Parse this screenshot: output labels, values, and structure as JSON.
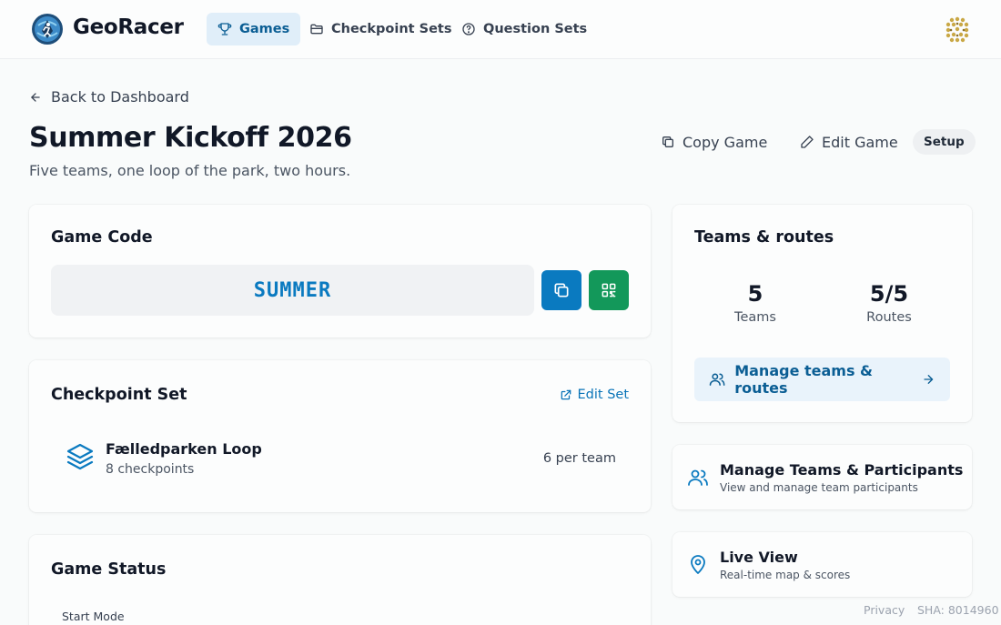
{
  "app": {
    "name": "GeoRacer"
  },
  "nav": {
    "items": [
      {
        "label": "Games",
        "icon": "trophy-icon",
        "active": true
      },
      {
        "label": "Checkpoint Sets",
        "icon": "folder-icon",
        "active": false
      },
      {
        "label": "Question Sets",
        "icon": "help-circle-icon",
        "active": false
      }
    ]
  },
  "header": {
    "back_label": "Back to Dashboard",
    "title": "Summer Kickoff 2026",
    "subtitle": "Five teams, one loop of the park, two hours.",
    "copy_label": "Copy Game",
    "edit_label": "Edit Game",
    "status_badge": "Setup"
  },
  "game_code": {
    "title": "Game Code",
    "code": "SUMMER"
  },
  "checkpoint_set": {
    "title": "Checkpoint Set",
    "edit_label": "Edit Set",
    "name": "Fælledparken Loop",
    "count": "8 checkpoints",
    "per_team": "6 per team"
  },
  "game_status": {
    "title": "Game Status",
    "start_mode_label": "Start Mode"
  },
  "teams_routes": {
    "title": "Teams & routes",
    "teams_value": "5",
    "teams_label": "Teams",
    "routes_value": "5/5",
    "routes_label": "Routes",
    "manage_label": "Manage teams & routes"
  },
  "participants_card": {
    "title": "Manage Teams & Participants",
    "subtitle": "View and manage team participants"
  },
  "live_view_card": {
    "title": "Live View",
    "subtitle": "Real-time map & scores"
  },
  "footer": {
    "privacy": "Privacy",
    "sha": "SHA: 8014960"
  },
  "colors": {
    "primary": "#0a7ac0",
    "qr_button": "#13985a",
    "accent_text": "#0b5e94"
  }
}
